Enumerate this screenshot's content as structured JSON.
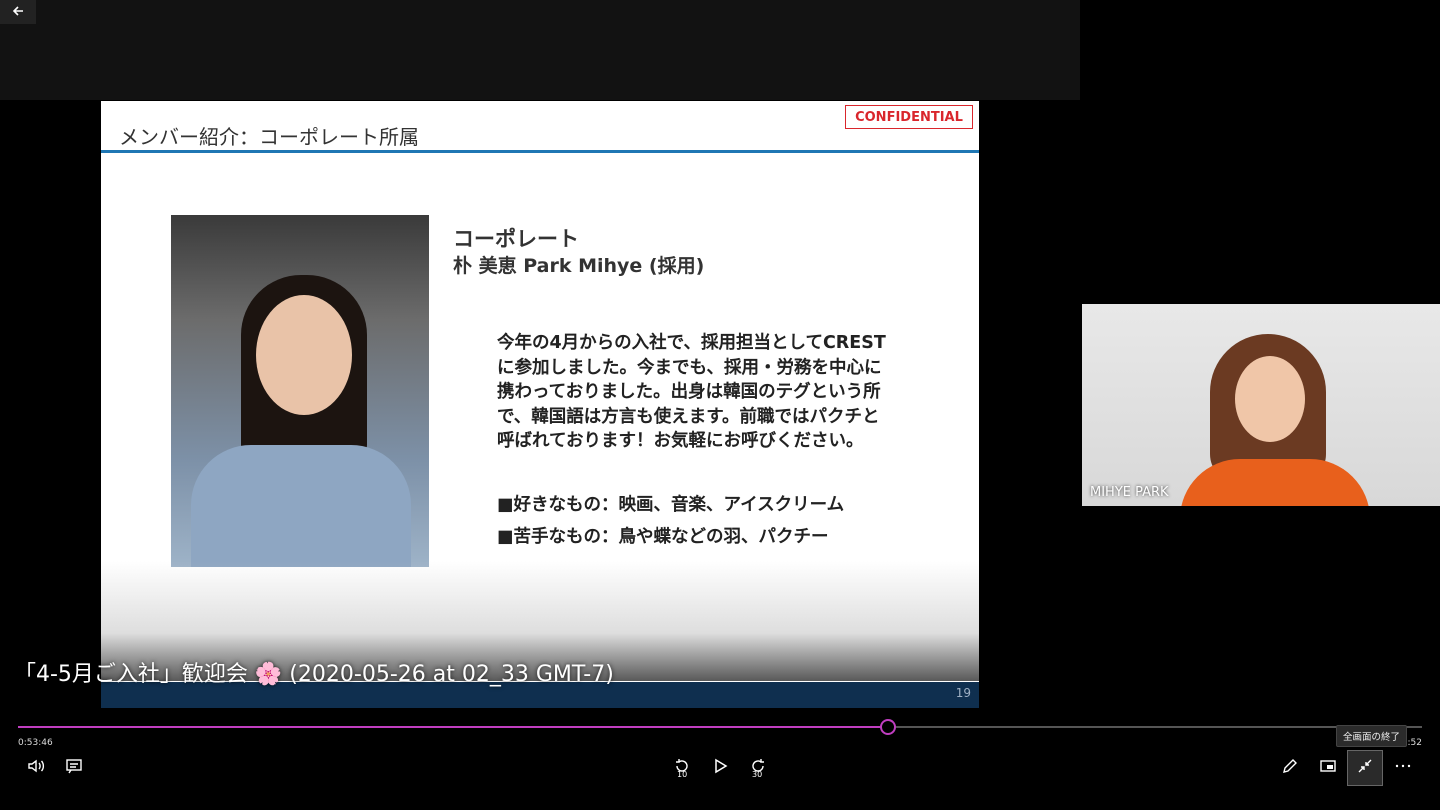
{
  "player": {
    "video_title": "「4-5月ご入社」歓迎会 🌸 (2020-05-26 at 02_33 GMT-7)",
    "elapsed": "0:53:46",
    "total": "32:52",
    "progress": 0.619,
    "tooltip": "全画面の終了",
    "rewind_seconds": "10",
    "forward_seconds": "30",
    "icons": {
      "back": "back-arrow-icon",
      "volume": "volume-icon",
      "captions": "captions-icon",
      "rewind": "rewind-10-icon",
      "play": "play-icon",
      "forward": "forward-30-icon",
      "pen": "pen-icon",
      "miniplayer": "miniplayer-icon",
      "exit_fullscreen": "exit-fullscreen-icon",
      "more": "more-icon"
    },
    "accent": "#c03ec0"
  },
  "slide": {
    "title": "メンバー紹介：コーポレート所属",
    "badge": "CONFIDENTIAL",
    "heading1": "コーポレート",
    "heading2": "朴 美恵 Park Mihye (採用)",
    "intro": "今年の4月からの入社で、採用担当としてCREST\nに参加しました。今までも、採用・労務を中心に\n携わっておりました。出身は韓国のテグという所\nで、韓国語は方言も使えます。前職ではパクチと\n呼ばれております！お気軽にお呼びください。",
    "likes": "■好きなもの：映画、音楽、アイスクリーム",
    "dislikes": "■苦手なもの：鳥や蝶などの羽、パクチー",
    "page_number": "19"
  },
  "participant": {
    "name": "MIHYE PARK"
  }
}
